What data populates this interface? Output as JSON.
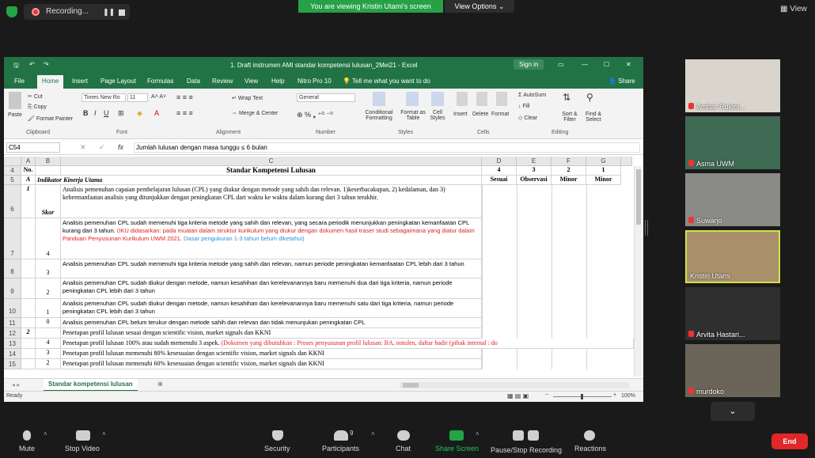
{
  "topbar": {
    "recording_label": "Recording...",
    "viewing_banner": "You are viewing Kristin Utami's screen",
    "view_options": "View Options",
    "view_button": "View"
  },
  "excel": {
    "title": "1. Draft instrumen AMI standar kompetensi lulusan_2Mei21  -  Excel",
    "sign_in": "Sign in",
    "tabs": [
      "File",
      "Home",
      "Insert",
      "Page Layout",
      "Formulas",
      "Data",
      "Review",
      "View",
      "Help",
      "Nitro Pro 10"
    ],
    "tell_me": "Tell me what you want to do",
    "share": "Share",
    "ribbon": {
      "paste": "Paste",
      "cut": "Cut",
      "copy": "Copy",
      "format_painter": "Format Painter",
      "clipboard": "Clipboard",
      "font_name": "Times New Ro",
      "font_size": "11",
      "font": "Font",
      "wrap_text": "Wrap Text",
      "merge_center": "Merge & Center",
      "alignment": "Alignment",
      "number_format": "General",
      "number": "Number",
      "conditional": "Conditional Formatting",
      "format_table": "Format as Table",
      "cell_styles": "Cell Styles",
      "styles": "Styles",
      "insert": "Insert",
      "delete": "Delete",
      "format": "Format",
      "cells": "Cells",
      "autosum": "AutoSum",
      "fill": "Fill",
      "clear": "Clear",
      "sort_filter": "Sort & Filter",
      "find_select": "Find & Select",
      "editing": "Editing"
    },
    "name_box": "C54",
    "formula": "Jumlah lulusan dengan masa tunggu ≤ 6 bulan",
    "columns": [
      "A",
      "B",
      "C",
      "D",
      "E",
      "F",
      "G"
    ],
    "header_row": {
      "no": "No.",
      "title": "Standar Kompetensi Lulusan",
      "d": "4",
      "e": "3",
      "f": "2",
      "g": "1"
    },
    "row5": {
      "a": "A",
      "b": "Indikator Kinerja Utama",
      "d": "Sesuai",
      "e": "Observasi",
      "f": "Minor",
      "g": "Minor"
    },
    "rows": [
      {
        "num": "6",
        "a": "1",
        "b": "Skor",
        "c": "Analisis pemenuhan capaian pembelajaran lulusan (CPL) yang diukur dengan metode yang sahih dan relevan. 1)keserbacakupan, 2) kedalaman, dan 3) kebermanfaatan analisis yang ditunjukkan dengan peningkatan CPL dari waktu ke waktu dalam kurang dari 3 tahun terakhir."
      },
      {
        "num": "7",
        "b": "4",
        "c": "Analisis pemenuhan CPL sudah memenuhi tiga kriteria metode yang sahih dan relevan, yang secara periodik menunjukkan peningkatan kemanfaatan CPL kurang dari 3 tahun.",
        "c_red": "(IKU didasarkan: pada muatan dalam struktur kurikulum yang diukur dengan dokumen hasil traser studi sebagaimana yang diatur dalam Panduan Penyusunan Kurikulum UWM 2021.",
        "c_blue": "Dasar pengukuran 1-3 tahun belum diketahui)"
      },
      {
        "num": "8",
        "b": "3",
        "c": "Analisis pemenuhan CPL sudah memenuhi tiga kriteria metode yang sahih dan relevan, namun periode peningkatan kemanfaatan CPL lebih dari 3 tahun"
      },
      {
        "num": "9",
        "b": "2",
        "c": "Analisis pemenuhan CPL sudah diukur dengan metode, namun kesahihan dan kerelevanannya baru memenuhi dua dari tiga kriteria, namun periode peningkatan CPL lebih dari 3 tahun"
      },
      {
        "num": "10",
        "b": "1",
        "c": "Analisis pemenuhan CPL sudah diukur dengan metode, namun kesahihan dan kerelevanannya baru memenuhi satu dari tiga kriteria, namun periode peningkatan CPL lebih dari 3 tahun"
      },
      {
        "num": "11",
        "b": "0",
        "c": "Analisis pemenuhan CPL  belum terukur dengan metode sahih dan relevan dan tidak menunjukan peningkatan CPL"
      },
      {
        "num": "12",
        "a": "2",
        "c": "Penetapan profil lulusan sesuai dengan scientific vision, market signals dan KKNI"
      },
      {
        "num": "13",
        "b": "4",
        "c": "Penetapan profil lulusan 100% atau sudah memenuhi 3 aspek.",
        "c_red": "(Dokumen yang dibutuhkan : Proses penyusunan profil lulusan: BA, notulen, daftar hadir (pihak internal : do"
      },
      {
        "num": "14",
        "b": "3",
        "c": "Penetapan profil lulusan memenuhi 80% kesesuaian dengan scientific vision, market signals dan KKNI"
      },
      {
        "num": "15",
        "b": "2",
        "c": "Penetapan profil lulusan memenuhi 60% kesesuaian dengan scientific vision, market signals dan KKNI"
      }
    ],
    "sheet_tab": "Standar kompetensi lulusan",
    "status": "Ready",
    "zoom": "100%"
  },
  "participants": [
    {
      "name": "Ambar Rukmi...",
      "bg": "#d9d4cc"
    },
    {
      "name": "Asma UWM",
      "bg": "#3f6a54"
    },
    {
      "name": "Suwarjo",
      "bg": "#8a8a86"
    },
    {
      "name": "Kristin Utami",
      "bg": "#a98f6a"
    },
    {
      "name": "Arvita Hastari...",
      "bg": "#2f2f2f"
    },
    {
      "name": "murdoko",
      "bg": "#6b6459"
    }
  ],
  "toolbar": {
    "mute": "Mute",
    "stop_video": "Stop Video",
    "security": "Security",
    "participants": "Participants",
    "participants_count": "9",
    "chat": "Chat",
    "share_screen": "Share Screen",
    "recording": "Pause/Stop Recording",
    "reactions": "Reactions",
    "end": "End"
  },
  "colors": {
    "excel_green": "#217346",
    "zoom_green": "#23a445",
    "end_red": "#e02828",
    "speaker_border": "#d4e24a"
  }
}
